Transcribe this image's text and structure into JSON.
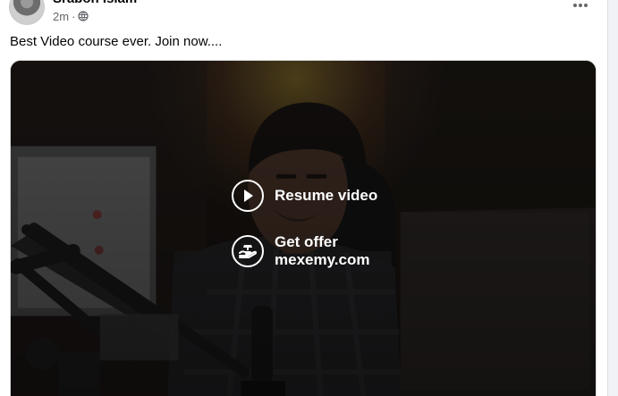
{
  "post": {
    "author_name": "Srabon Islam",
    "time": "2m",
    "separator": "·",
    "privacy_icon": "globe-icon",
    "more_icon": "more-horizontal-icon",
    "text": "Best Video course ever. Join now...."
  },
  "video_overlay": {
    "resume_label": "Resume video",
    "resume_icon": "play-icon",
    "offer_label": "Get offer",
    "offer_domain": "mexemy.com",
    "offer_icon": "offer-hand-icon"
  },
  "colors": {
    "text_primary": "#050505",
    "text_secondary": "#65676b",
    "overlay_text": "#ffffff"
  }
}
